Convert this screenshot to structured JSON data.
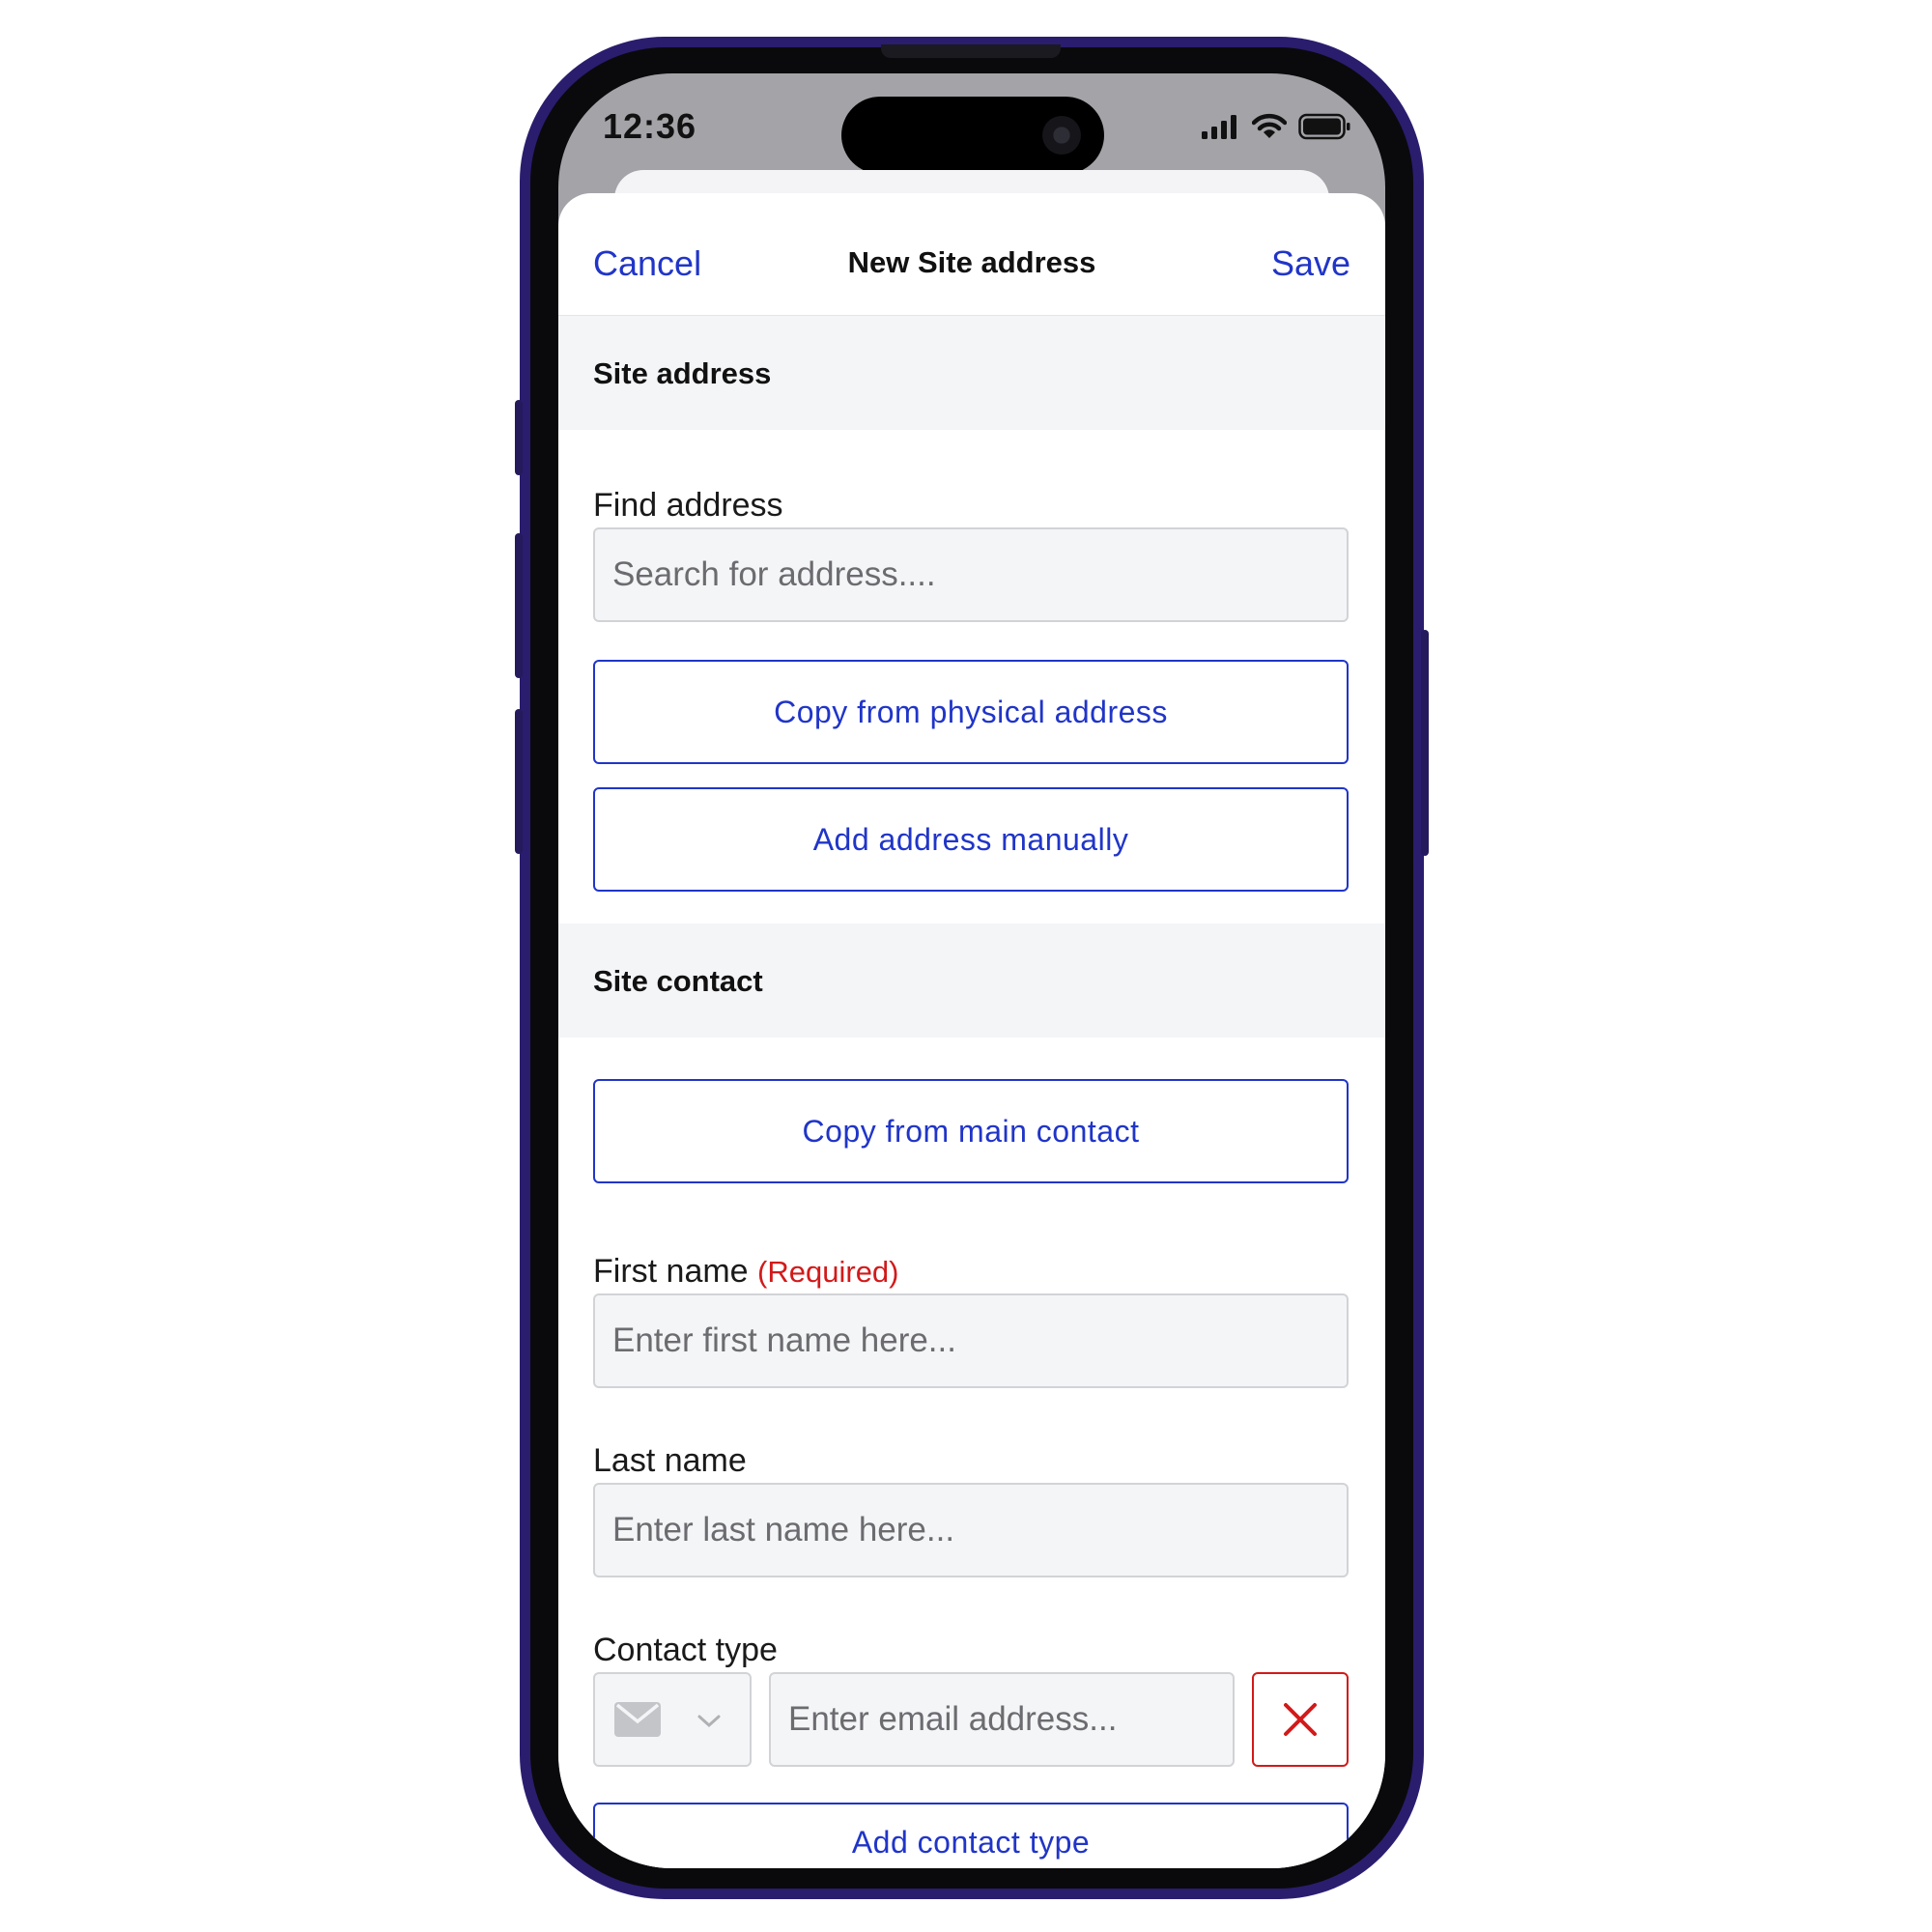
{
  "status_bar": {
    "time": "12:36"
  },
  "nav": {
    "cancel": "Cancel",
    "title": "New Site address",
    "save": "Save"
  },
  "site_address": {
    "header": "Site address",
    "find_label": "Find address",
    "find_placeholder": "Search for address....",
    "copy_physical": "Copy from physical address",
    "add_manual": "Add address manually"
  },
  "site_contact": {
    "header": "Site contact",
    "copy_main": "Copy from main contact",
    "first_name_label": "First name",
    "required": "(Required)",
    "first_name_placeholder": "Enter first name here...",
    "last_name_label": "Last name",
    "last_name_placeholder": "Enter last name here...",
    "contact_type_label": "Contact type",
    "contact_type_selected_icon": "envelope-icon",
    "email_placeholder": "Enter email address...",
    "add_contact_type": "Add contact type"
  },
  "colors": {
    "accent": "#2035c8",
    "danger": "#d21a1a",
    "phone_frame": "#2a1d6e"
  }
}
